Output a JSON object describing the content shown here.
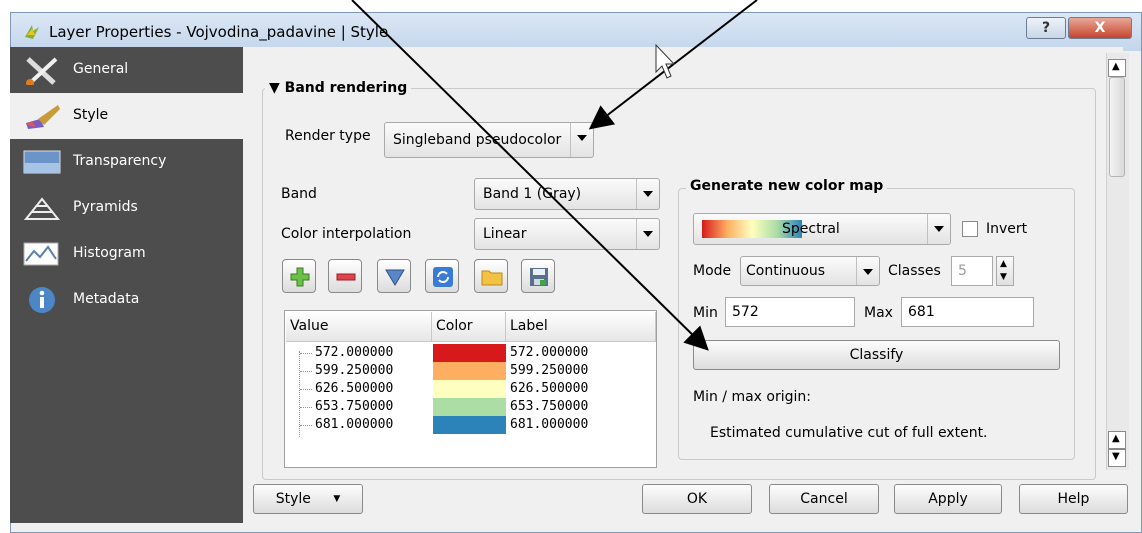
{
  "window": {
    "title": "Layer Properties - Vojvodina_padavine | Style",
    "help_label": "?",
    "close_label": "X"
  },
  "sidebar": {
    "items": [
      {
        "label": "General",
        "icon": "wrench-screwdriver-icon"
      },
      {
        "label": "Style",
        "icon": "paintbrush-icon"
      },
      {
        "label": "Transparency",
        "icon": "transparency-icon"
      },
      {
        "label": "Pyramids",
        "icon": "pyramids-icon"
      },
      {
        "label": "Histogram",
        "icon": "histogram-icon"
      },
      {
        "label": "Metadata",
        "icon": "info-icon"
      }
    ],
    "active": "Style"
  },
  "band_rendering": {
    "title": "Band rendering",
    "render_type_label": "Render type",
    "render_type_value": "Singleband pseudocolor",
    "band_label": "Band",
    "band_value": "Band 1 (Gray)",
    "interp_label": "Color interpolation",
    "interp_value": "Linear"
  },
  "table": {
    "headers": [
      "Value",
      "Color",
      "Label"
    ],
    "rows": [
      {
        "value": "572.000000",
        "color": "#d7191c",
        "label": "572.000000"
      },
      {
        "value": "599.250000",
        "color": "#fdae61",
        "label": "599.250000"
      },
      {
        "value": "626.500000",
        "color": "#ffffbf",
        "label": "626.500000"
      },
      {
        "value": "653.750000",
        "color": "#abdda4",
        "label": "653.750000"
      },
      {
        "value": "681.000000",
        "color": "#2b83ba",
        "label": "681.000000"
      }
    ]
  },
  "color_map": {
    "title": "Generate new color map",
    "ramp_value": "Spectral",
    "invert_label": "Invert",
    "mode_label": "Mode",
    "mode_value": "Continuous",
    "classes_label": "Classes",
    "classes_value": "5",
    "min_label": "Min",
    "min_value": "572",
    "max_label": "Max",
    "max_value": "681",
    "classify_label": "Classify",
    "origin_label": "Min / max origin:",
    "origin_value": "Estimated cumulative cut of full extent."
  },
  "footer": {
    "style_label": "Style",
    "ok_label": "OK",
    "cancel_label": "Cancel",
    "apply_label": "Apply",
    "help_label": "Help"
  }
}
